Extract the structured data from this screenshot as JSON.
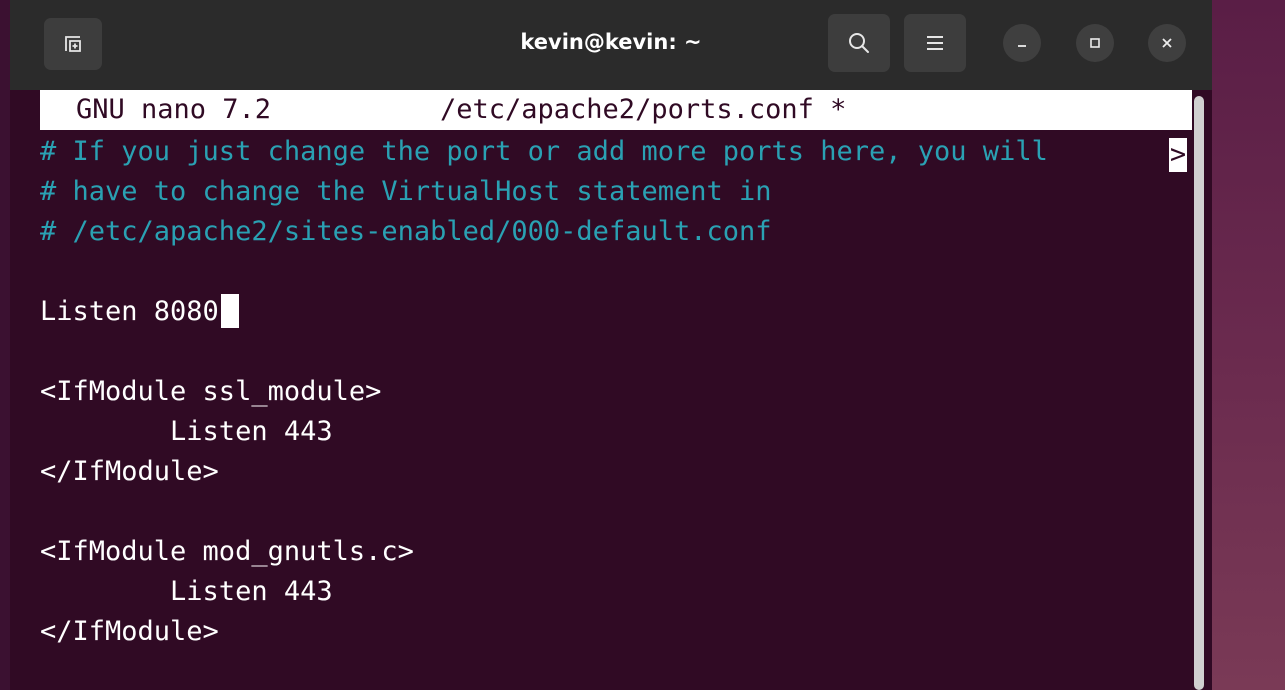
{
  "window": {
    "title": "kevin@kevin: ~"
  },
  "nano": {
    "version_label": "GNU nano 7.2",
    "filename": "/etc/apache2/ports.conf *",
    "overflow_marker": ">"
  },
  "editor_lines": [
    "# If you just change the port or add more ports here, you will",
    "# have to change the VirtualHost statement in",
    "# /etc/apache2/sites-enabled/000-default.conf",
    "",
    "Listen 8080",
    "",
    "<IfModule ssl_module>",
    "        Listen 443",
    "</IfModule>",
    "",
    "<IfModule mod_gnutls.c>",
    "        Listen 443",
    "</IfModule>"
  ],
  "colors": {
    "terminal_bg": "#300a24",
    "headerbar_bg": "#2b2b2b",
    "comment": "#2aa1b3",
    "text": "#ffffff"
  }
}
